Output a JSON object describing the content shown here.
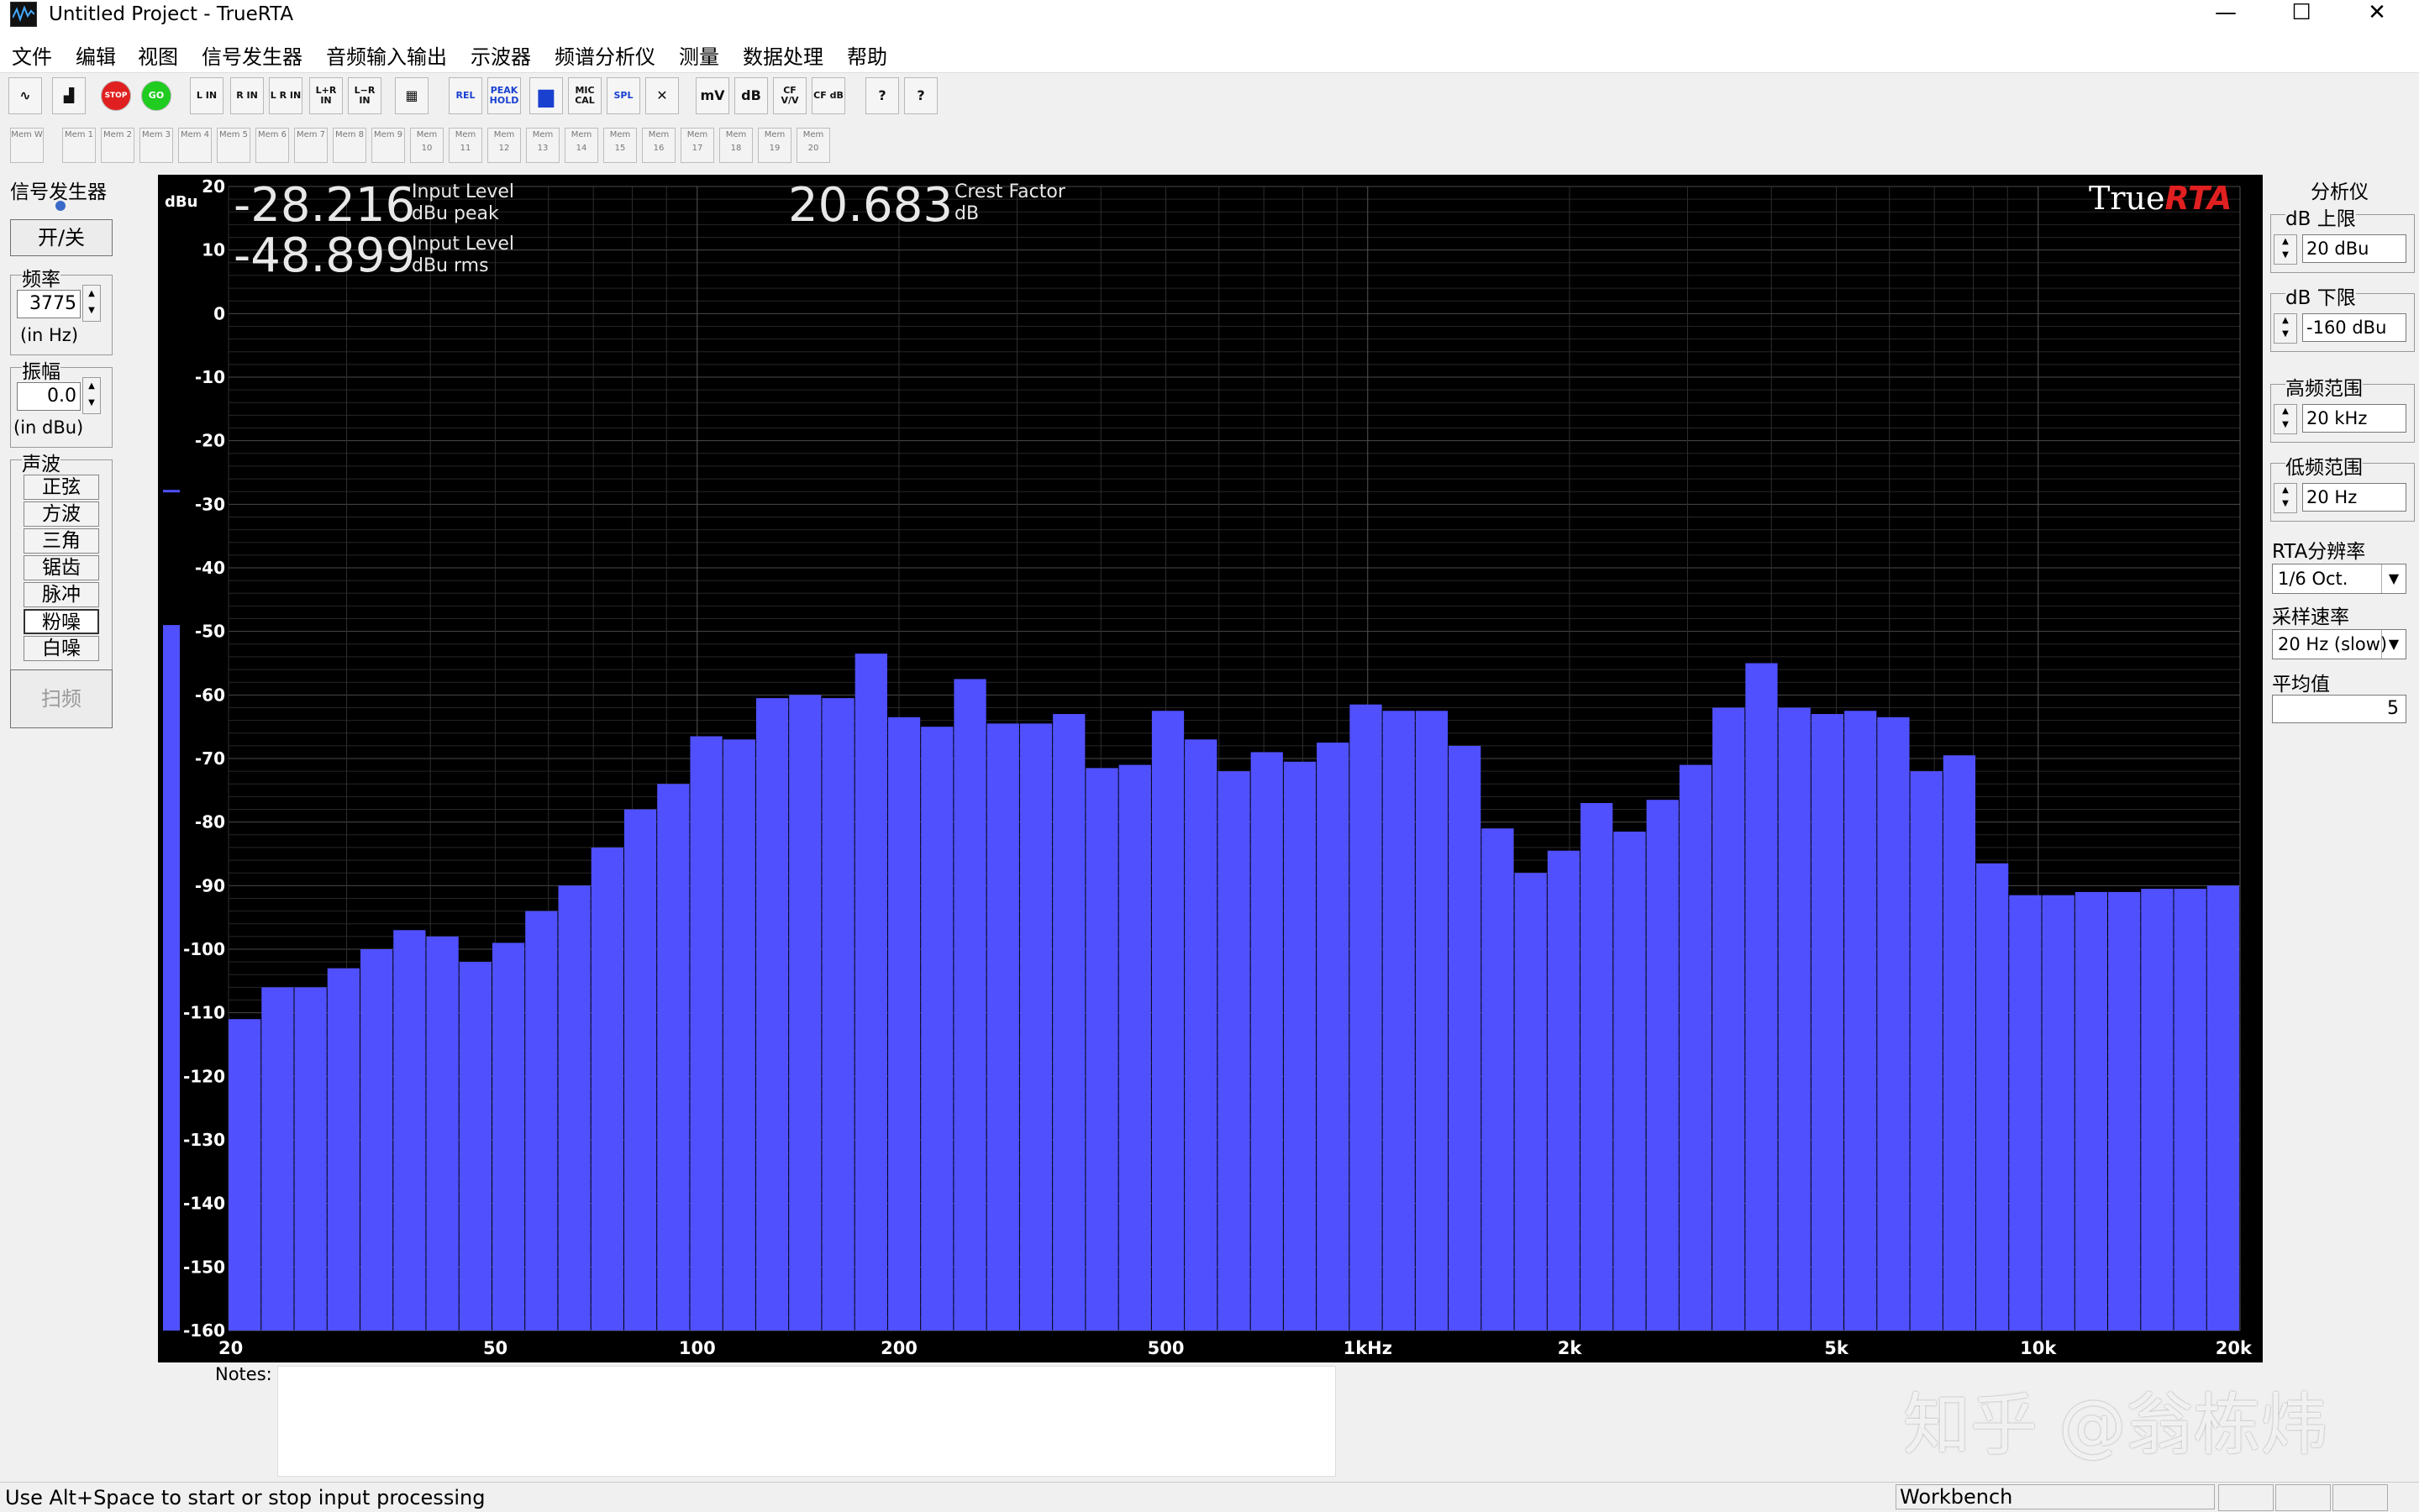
{
  "window": {
    "title": "Untitled Project - TrueRTA",
    "minimize": "—",
    "maximize": "☐",
    "close": "✕"
  },
  "menu": [
    "文件",
    "编辑",
    "视图",
    "信号发生器",
    "音频输入输出",
    "示波器",
    "频谱分析仪",
    "测量",
    "数据处理",
    "帮助"
  ],
  "toolbar1": [
    {
      "id": "sine-view",
      "label": "∿"
    },
    {
      "id": "spectrum-view",
      "label": "▟"
    },
    {
      "id": "stop",
      "label": "STOP"
    },
    {
      "id": "go",
      "label": "GO"
    },
    {
      "id": "l-in",
      "label": "L IN"
    },
    {
      "id": "r-in",
      "label": "R IN"
    },
    {
      "id": "lr-in",
      "label": "L R IN"
    },
    {
      "id": "lplusr-in",
      "label": "L+R IN"
    },
    {
      "id": "lminusr-in",
      "label": "L−R IN"
    },
    {
      "id": "grid",
      "label": "▦"
    },
    {
      "id": "rel",
      "label": "REL"
    },
    {
      "id": "peak-hold",
      "label": "PEAK HOLD"
    },
    {
      "id": "bars",
      "label": "▆"
    },
    {
      "id": "mic-cal",
      "label": "MIC CAL"
    },
    {
      "id": "spl",
      "label": "SPL"
    },
    {
      "id": "x",
      "label": "✕"
    },
    {
      "id": "mv",
      "label": "mV"
    },
    {
      "id": "db",
      "label": "dB"
    },
    {
      "id": "cf-vv",
      "label": "CF V/V"
    },
    {
      "id": "cf-db",
      "label": "CF dB"
    },
    {
      "id": "help",
      "label": "?"
    },
    {
      "id": "help-context",
      "label": "?"
    }
  ],
  "memory_buttons": [
    "Mem W",
    "Mem 1",
    "Mem 2",
    "Mem 3",
    "Mem 4",
    "Mem 5",
    "Mem 6",
    "Mem 7",
    "Mem 8",
    "Mem 9",
    "Mem 10",
    "Mem 11",
    "Mem 12",
    "Mem 13",
    "Mem 14",
    "Mem 15",
    "Mem 16",
    "Mem 17",
    "Mem 18",
    "Mem 19",
    "Mem 20"
  ],
  "generator": {
    "title": "信号发生器",
    "power_button": "开/关",
    "freq_label": "频率",
    "freq_value": "3775",
    "freq_unit": "(in Hz)",
    "amp_label": "振幅",
    "amp_value": "0.0",
    "amp_unit": "(in dBu)",
    "wave_label": "声波",
    "waves": [
      "正弦",
      "方波",
      "三角",
      "锯齿",
      "脉冲",
      "粉噪",
      "白噪"
    ],
    "selected_wave": "粉噪",
    "sweep_button": "扫频"
  },
  "analyzer": {
    "title": "分析仪",
    "db_upper_label": "dB 上限",
    "db_upper_value": "20 dBu",
    "db_lower_label": "dB 下限",
    "db_lower_value": "-160 dBu",
    "high_freq_label": "高频范围",
    "high_freq_value": "20 kHz",
    "low_freq_label": "低频范围",
    "low_freq_value": "20 Hz",
    "resolution_label": "RTA分辨率",
    "resolution_value": "1/6 Oct.",
    "rate_label": "采样速率",
    "rate_value": "20 Hz (slow)",
    "avg_label": "平均值",
    "avg_value": "5"
  },
  "readouts": {
    "peak_value": "-28.216",
    "peak_label1": "Input Level",
    "peak_label2": "dBu peak",
    "rms_value": "-48.899",
    "rms_label1": "Input Level",
    "rms_label2": "dBu rms",
    "crest_value": "20.683",
    "crest_label1": "Crest Factor",
    "crest_label2": "dB",
    "logo_true": "True",
    "logo_rta": "RTA"
  },
  "chart_data": {
    "type": "bar",
    "ylabel": "dBu",
    "ylim": [
      -160,
      20
    ],
    "y_ticks": [
      20,
      10,
      0,
      -10,
      -20,
      -30,
      -40,
      -50,
      -60,
      -70,
      -80,
      -90,
      -100,
      -110,
      -120,
      -130,
      -140,
      -150,
      -160
    ],
    "xscale": "log",
    "xlim": [
      20,
      20000
    ],
    "x_ticks": [
      {
        "v": 20,
        "label": "20"
      },
      {
        "v": 50,
        "label": "50"
      },
      {
        "v": 100,
        "label": "100"
      },
      {
        "v": 200,
        "label": "200"
      },
      {
        "v": 500,
        "label": "500"
      },
      {
        "v": 1000,
        "label": "1kHz"
      },
      {
        "v": 2000,
        "label": "2k"
      },
      {
        "v": 5000,
        "label": "5k"
      },
      {
        "v": 10000,
        "label": "10k"
      },
      {
        "v": 20000,
        "label": "20k"
      }
    ],
    "bar_color": "#5050ff",
    "grid": true,
    "values": [
      -111,
      -106,
      -106,
      -103,
      -100,
      -97,
      -98,
      -102,
      -99,
      -94,
      -90,
      -84,
      -78,
      -74,
      -66.5,
      -67,
      -60.5,
      -60,
      -60.5,
      -53.5,
      -63.5,
      -65,
      -57.5,
      -64.5,
      -64.5,
      -63,
      -71.5,
      -71,
      -62.5,
      -67,
      -72,
      -69,
      -70.5,
      -67.5,
      -61.5,
      -62.5,
      -62.5,
      -68,
      -81,
      -88,
      -84.5,
      -77,
      -81.5,
      -76.5,
      -71,
      -62,
      -55,
      -62,
      -63,
      -62.5,
      -63.5,
      -72,
      -69.5,
      -86.5,
      -91.5,
      -91.5,
      -91,
      -91,
      -90.5,
      -90.5,
      -90
    ],
    "level_meter": {
      "rms": -49,
      "peak": -28
    }
  },
  "notes": {
    "label": "Notes:"
  },
  "status": {
    "text": "Use Alt+Space to start or stop input processing",
    "pane": "Workbench"
  },
  "watermark": "知乎 @翁栋炜"
}
